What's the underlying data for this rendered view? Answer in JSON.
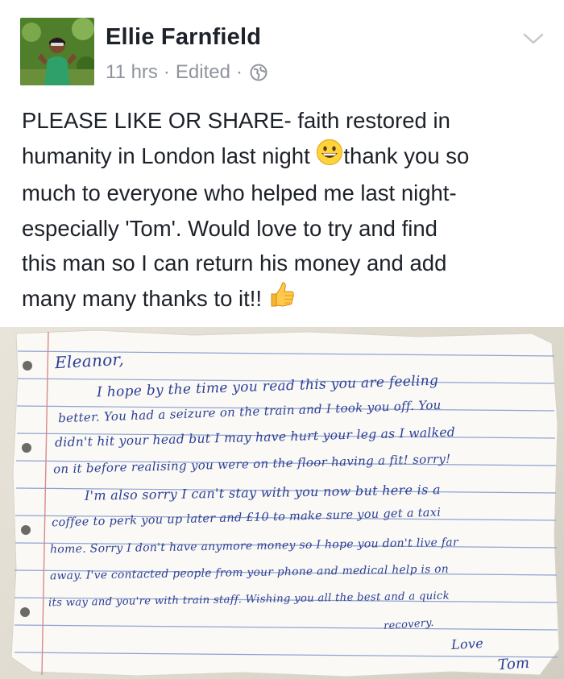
{
  "post": {
    "author": "Ellie Farnfield",
    "time": "11 hrs",
    "separator": "·",
    "edited": "Edited",
    "separator2": "·",
    "privacy_icon": "globe-icon",
    "menu_icon": "chevron-down-icon",
    "text_lines": [
      "PLEASE LIKE OR SHARE- faith restored in",
      "humanity in London last night",
      "thank you so",
      "much to everyone who helped me last night-",
      "especially 'Tom'. Would love to try and find",
      "this man so I can return his money and add",
      "many many thanks to it!!"
    ],
    "emoji_smile": "grinning-face-emoji",
    "emoji_thumbs": "thumbs-up-emoji"
  },
  "note": {
    "lines": [
      "Eleanor,",
      "I hope by the time you read this you are feeling",
      "better. You had a seizure on the train and I took you off. You",
      "didn't hit your head but I may have hurt your leg as I walked",
      "on it before realising you were on the floor having a fit! sorry!",
      "I'm also sorry I can't stay with you now but here is a",
      "coffee to perk you up later and £10 to make sure you get a taxi",
      "home. Sorry I don't have anymore money so I hope you don't live far",
      "away. I've contacted people from your phone and medical help is on",
      "its way and you're with train staff. Wishing you all the best and a quick",
      "recovery.",
      "Love",
      "Tom"
    ]
  },
  "colors": {
    "name": "#1d2129",
    "meta": "#90949c",
    "ink": "#2c3f95",
    "paper_line": "#8fa3cf",
    "margin_line": "#d98a8a"
  }
}
